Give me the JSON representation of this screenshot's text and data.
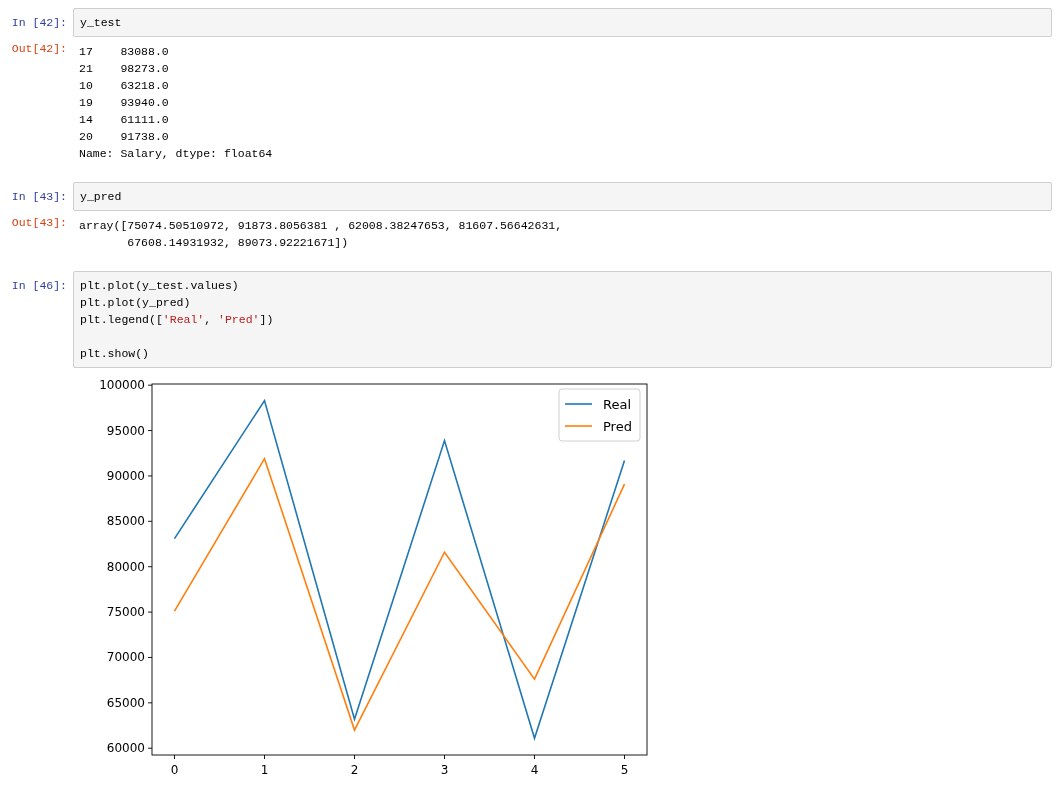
{
  "cells": [
    {
      "prompt": "In [42]:",
      "code": [
        {
          "kind": "code",
          "segments": [
            {
              "text": "y_test",
              "kind": "plain"
            }
          ]
        }
      ],
      "output": {
        "prompt": "Out[42]:",
        "lines": [
          "17    83088.0",
          "21    98273.0",
          "10    63218.0",
          "19    93940.0",
          "14    61111.0",
          "20    91738.0",
          "Name: Salary, dtype: float64"
        ]
      }
    },
    {
      "prompt": "In [43]:",
      "code": [
        {
          "kind": "code",
          "segments": [
            {
              "text": "y_pred",
              "kind": "plain"
            }
          ]
        }
      ],
      "output": {
        "prompt": "Out[43]:",
        "lines": [
          "array([75074.50510972, 91873.8056381 , 62008.38247653, 81607.56642631,",
          "       67608.14931932, 89073.92221671])"
        ]
      }
    },
    {
      "prompt": "In [46]:",
      "code": [
        {
          "kind": "code",
          "segments": [
            {
              "text": "plt.plot(y_test.values)",
              "kind": "plain"
            }
          ]
        },
        {
          "kind": "code",
          "segments": [
            {
              "text": "plt.plot(y_pred)",
              "kind": "plain"
            }
          ]
        },
        {
          "kind": "code",
          "segments": [
            {
              "text": "plt.legend([",
              "kind": "plain"
            },
            {
              "text": "'Real'",
              "kind": "string"
            },
            {
              "text": ", ",
              "kind": "plain"
            },
            {
              "text": "'Pred'",
              "kind": "string"
            },
            {
              "text": "])",
              "kind": "plain"
            }
          ]
        },
        {
          "kind": "blank"
        },
        {
          "kind": "code",
          "segments": [
            {
              "text": "plt.show()",
              "kind": "plain"
            }
          ]
        }
      ],
      "output": {
        "chart_data": {
          "type": "line",
          "x": [
            0,
            1,
            2,
            3,
            4,
            5
          ],
          "xlim": [
            -0.25,
            5.25
          ],
          "ylim": [
            59253,
            100131
          ],
          "xticks": [
            0,
            1,
            2,
            3,
            4,
            5
          ],
          "yticks": [
            60000,
            65000,
            70000,
            75000,
            80000,
            85000,
            90000,
            95000,
            100000
          ],
          "legend": true,
          "series": [
            {
              "name": "Real",
              "color": "#1f77b4",
              "values": [
                83100,
                98300,
                63200,
                93900,
                61100,
                91700
              ]
            },
            {
              "name": "Pred",
              "color": "#ff7f0e",
              "values": [
                75100,
                91900,
                62000,
                81600,
                67600,
                89100
              ]
            }
          ]
        }
      }
    }
  ]
}
